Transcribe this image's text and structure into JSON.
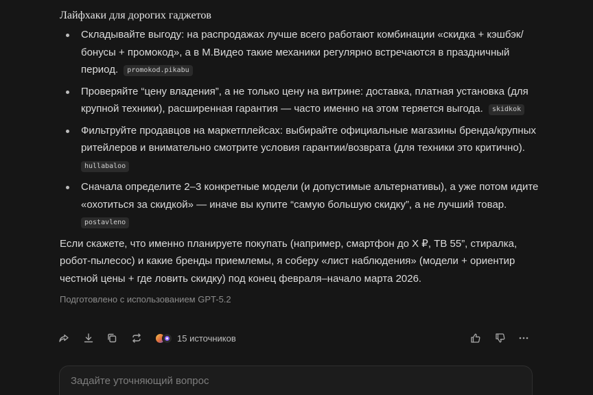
{
  "section_title": "Лайфхаки для дорогих гаджетов",
  "tips": [
    {
      "text": "Складывайте выгоду: на распродажах лучше всего работают комбинации «скидка + кэшбэк/бонусы + промокод», а в М.Видео такие механики регулярно встречаются в праздничный период.",
      "code": "promokod.pikabu",
      "code_inline": true
    },
    {
      "text": "Проверяйте “цену владения”, а не только цену на витрине: доставка, платная установка (для крупной техники), расширенная гарантия — часто именно на этом теряется выгода.",
      "code": "skidkok",
      "code_inline": true
    },
    {
      "text": "Фильтруйте продавцов на маркетплейсах: выбирайте официальные магазины бренда/крупных ритейлеров и внимательно смотрите условия гарантии/возврата (для техники это критично).",
      "code": "hullabaloo",
      "code_inline": false
    },
    {
      "text": "Сначала определите 2–3 конкретные модели (и допустимые альтернативы), а уже потом идите «охотиться за скидкой» — иначе вы купите “самую большую скидку”, а не лучший товар.",
      "code": "postavleno",
      "code_inline": false
    }
  ],
  "closing_paragraph": "Если скажете, что именно планируете покупать (например, смартфон до X ₽, ТВ 55”, стиралка, робот-пылесос) и какие бренды приемлемы, я соберу «лист наблюдения» (модели + ориентир честной цены + где ловить скидку) под конец февраля–начало марта 2026.",
  "prepared_with": "Подготовлено с использованием GPT-5.2",
  "actions": {
    "share_icon": "share-icon",
    "download_icon": "download-icon",
    "copy_icon": "copy-icon",
    "regenerate_icon": "regenerate-icon",
    "sources_label": "15 источников",
    "like_icon": "thumbs-up-icon",
    "dislike_icon": "thumbs-down-icon",
    "more_icon": "more-icon"
  },
  "input": {
    "placeholder": "Задайте уточняющий вопрос",
    "value": ""
  },
  "colors": {
    "background": "#161616",
    "text": "#dcdcdc",
    "muted": "#8c8c8c",
    "code_bg": "#2b2b2b"
  }
}
